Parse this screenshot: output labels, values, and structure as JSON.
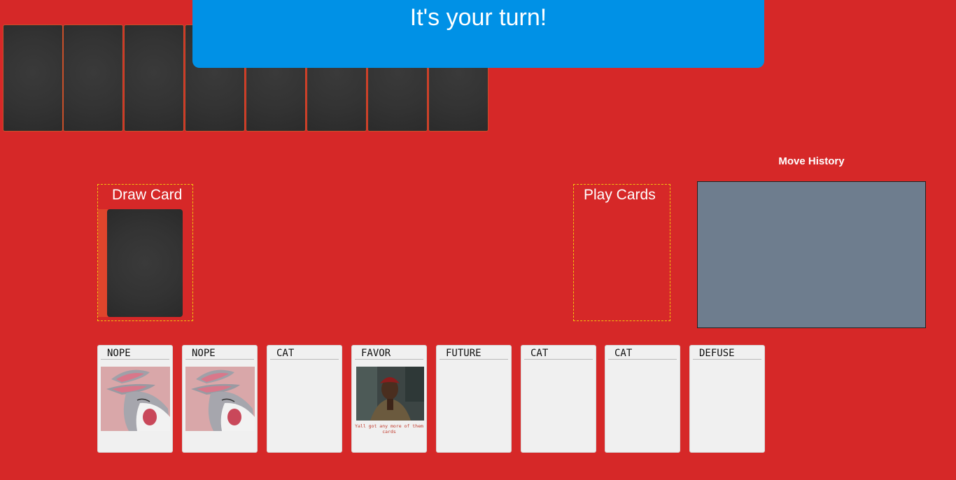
{
  "banner": {
    "text": "It's your turn!"
  },
  "opponent_hand": {
    "count": 8
  },
  "draw_zone": {
    "title": "Draw Card"
  },
  "play_zone": {
    "title": "Play Cards"
  },
  "move_history": {
    "title": "Move History",
    "entries": []
  },
  "hand": [
    {
      "label": "NOPE",
      "art": "bunny"
    },
    {
      "label": "NOPE",
      "art": "bunny"
    },
    {
      "label": "CAT",
      "art": ""
    },
    {
      "label": "FAVOR",
      "art": "favor",
      "caption": "Yall got any more of them cards"
    },
    {
      "label": "FUTURE",
      "art": ""
    },
    {
      "label": "CAT",
      "art": ""
    },
    {
      "label": "CAT",
      "art": ""
    },
    {
      "label": "DEFUSE",
      "art": ""
    }
  ],
  "colors": {
    "table": "#d62828",
    "banner": "#0091e6",
    "card_back": "#333333",
    "history_panel": "#6e7d8e",
    "zone_border": "#f1c40f"
  }
}
